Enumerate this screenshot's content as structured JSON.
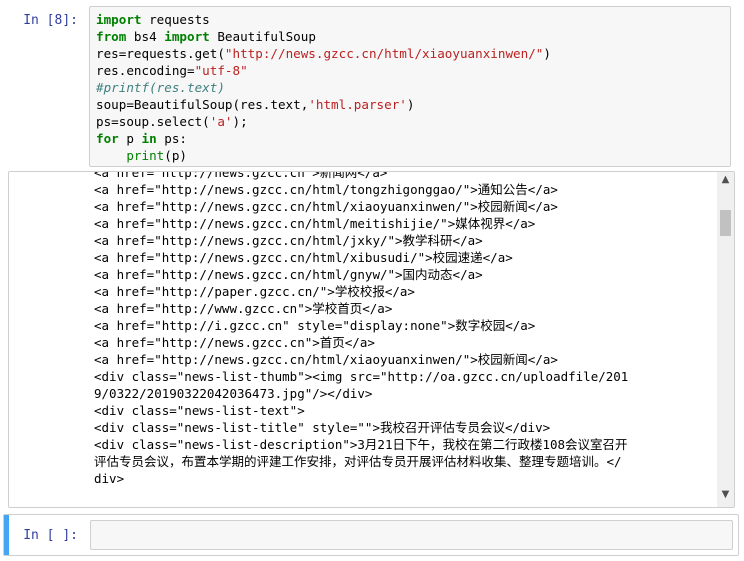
{
  "cell1": {
    "prompt": "In [8]:",
    "code": [
      [
        {
          "t": "import",
          "c": "kw"
        },
        {
          "t": " requests",
          "c": ""
        }
      ],
      [
        {
          "t": "from",
          "c": "kw"
        },
        {
          "t": " bs4 ",
          "c": ""
        },
        {
          "t": "import",
          "c": "kw"
        },
        {
          "t": " BeautifulSoup",
          "c": ""
        }
      ],
      [
        {
          "t": "res=requests.get(",
          "c": ""
        },
        {
          "t": "\"http://news.gzcc.cn/html/xiaoyuanxinwen/\"",
          "c": "str"
        },
        {
          "t": ")",
          "c": ""
        }
      ],
      [
        {
          "t": "res.encoding=",
          "c": ""
        },
        {
          "t": "\"utf-8\"",
          "c": "str"
        }
      ],
      [
        {
          "t": "#printf(res.text)",
          "c": "com"
        }
      ],
      [
        {
          "t": "soup=BeautifulSoup(res.text,",
          "c": ""
        },
        {
          "t": "'html.parser'",
          "c": "str"
        },
        {
          "t": ")",
          "c": ""
        }
      ],
      [
        {
          "t": "ps=soup.select(",
          "c": ""
        },
        {
          "t": "'a'",
          "c": "str"
        },
        {
          "t": ");",
          "c": ""
        }
      ],
      [
        {
          "t": "for",
          "c": "kw"
        },
        {
          "t": " p ",
          "c": ""
        },
        {
          "t": "in",
          "c": "kw"
        },
        {
          "t": " ps:",
          "c": ""
        }
      ],
      [
        {
          "t": "    ",
          "c": ""
        },
        {
          "t": "print",
          "c": "bi"
        },
        {
          "t": "(p)",
          "c": ""
        }
      ]
    ]
  },
  "output": {
    "lines": [
      "<a href=\"http://news.gzcc.cn\">新闻网</a>",
      "<a href=\"http://news.gzcc.cn/html/tongzhigonggao/\">通知公告</a>",
      "<a href=\"http://news.gzcc.cn/html/xiaoyuanxinwen/\">校园新闻</a>",
      "<a href=\"http://news.gzcc.cn/html/meitishijie/\">媒体视界</a>",
      "<a href=\"http://news.gzcc.cn/html/jxky/\">教学科研</a>",
      "<a href=\"http://news.gzcc.cn/html/xibusudi/\">校园速递</a>",
      "<a href=\"http://news.gzcc.cn/html/gnyw/\">国内动态</a>",
      "<a href=\"http://paper.gzcc.cn/\">学校校报</a>",
      "<a href=\"http://www.gzcc.cn\">学校首页</a>",
      "<a href=\"http://i.gzcc.cn\" style=\"display:none\">数字校园</a>",
      "<a href=\"http://news.gzcc.cn\">首页</a>",
      "<a href=\"http://news.gzcc.cn/html/xiaoyuanxinwen/\">校园新闻</a>",
      "<div class=\"news-list-thumb\"><img src=\"http://oa.gzcc.cn/uploadfile/201",
      "9/0322/20190322042036473.jpg\"/></div>",
      "<div class=\"news-list-text\">",
      "<div class=\"news-list-title\" style=\"\">我校召开评估专员会议</div>",
      "<div class=\"news-list-description\">3月21日下午，我校在第二行政楼108会议室召开",
      "评估专员会议，布置本学期的评建工作安排，对评估专员开展评估材料收集、整理专题培训。</",
      "div>"
    ]
  },
  "cell2": {
    "prompt": "In [ ]:"
  },
  "icons": {
    "scroll_up": "scroll-up-arrow-icon",
    "scroll_down": "scroll-down-arrow-icon"
  },
  "colors": {
    "prompt": "#303f9f",
    "keyword": "#008000",
    "string": "#ba2121",
    "comment": "#408080",
    "active_cell_bar": "#42a5f5"
  }
}
